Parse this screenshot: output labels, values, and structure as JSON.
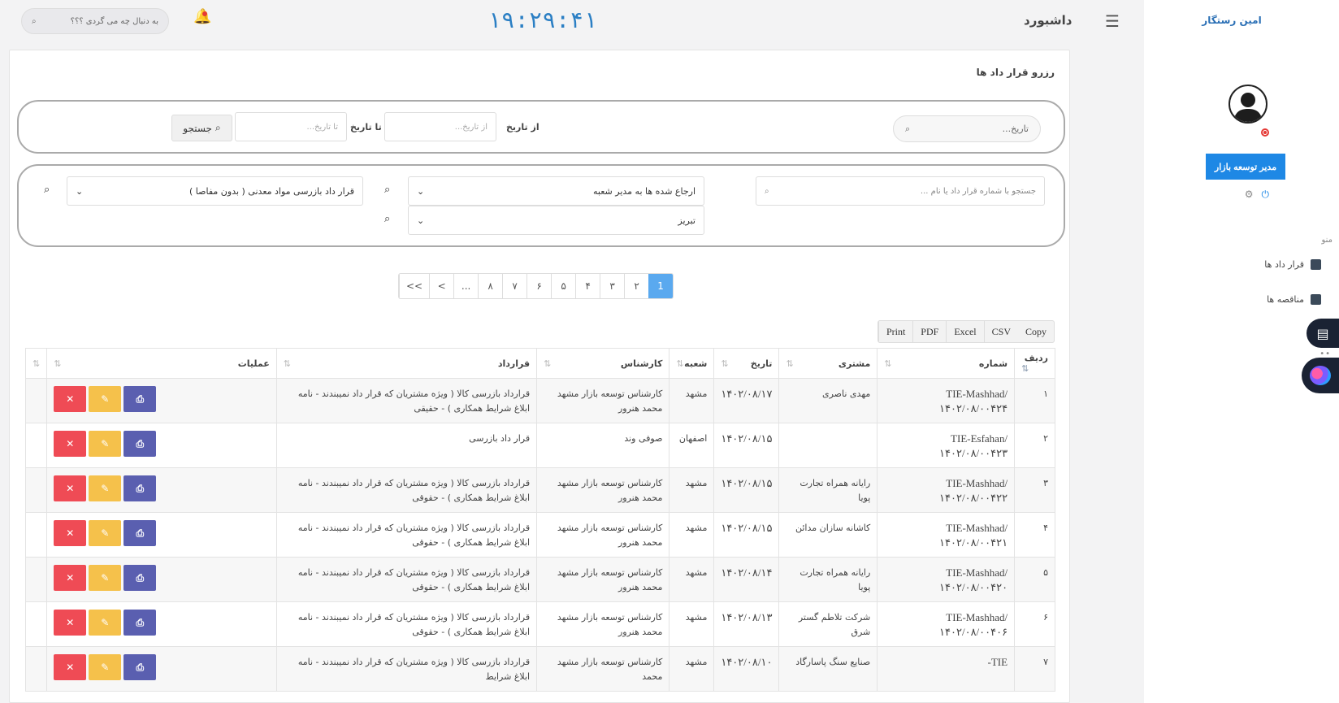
{
  "sidebar": {
    "user_name": "امین رستگار",
    "role_button": "مدیر توسعه بازار",
    "menu_title": "منو",
    "items": [
      {
        "label": "قرار داد ها"
      },
      {
        "label": "مناقصه ها"
      }
    ]
  },
  "header": {
    "title": "داشبورد",
    "clock": "۱۹:۲۹:۴۱",
    "search_placeholder": "به دنبال چه می گردی ؟؟؟"
  },
  "card": {
    "title": "رزرو قرار داد ها",
    "date_search_placeholder": "تاریخ...",
    "from_date_label": "از تاریخ",
    "from_date_placeholder": "از تاریخ...",
    "to_date_label": "تا تاریخ",
    "to_date_placeholder": "تا تاریخ...",
    "search_button": "جستجو",
    "contract_search_placeholder": "جستجو با شماره قرار داد یا نام ...",
    "status_select": "ارجاع شده ها به مدیر شعبه",
    "city_select": "تبریز",
    "type_select": "قرار داد بازرسی مواد معدنی ( بدون مفاصا )"
  },
  "pagination": [
    "1",
    "۲",
    "۳",
    "۴",
    "۵",
    "۶",
    "۷",
    "۸",
    "...",
    ">",
    ">>"
  ],
  "exports": [
    "Copy",
    "CSV",
    "Excel",
    "PDF",
    "Print"
  ],
  "table": {
    "headers": [
      "ردیف",
      "شماره",
      "مشتری",
      "تاریخ",
      "شعبه",
      "کارشناس",
      "قرارداد",
      "عملیات"
    ],
    "rows": [
      {
        "idx": "۱",
        "number": "TIE-Mashhad/۱۴۰۲/۰۸/۰۰۴۲۴",
        "customer": "مهدی ناصری",
        "date": "۱۴۰۲/۰۸/۱۷",
        "branch": "مشهد",
        "expert": "کارشناس توسعه بازار مشهد محمد هنرور",
        "contract": "قرارداد بازرسی کالا ( ویژه مشتریان که قرار داد نمیبندند - نامه ابلاغ شرایط همکاری ) - حقیقی"
      },
      {
        "idx": "۲",
        "number": "TIE-Esfahan/۱۴۰۲/۰۸/۰۰۴۲۳",
        "customer": "",
        "date": "۱۴۰۲/۰۸/۱۵",
        "branch": "اصفهان",
        "expert": "صوفی وند",
        "contract": "قرار داد بازرسی"
      },
      {
        "idx": "۳",
        "number": "TIE-Mashhad/۱۴۰۲/۰۸/۰۰۴۲۲",
        "customer": "رایانه همراه تجارت پویا",
        "date": "۱۴۰۲/۰۸/۱۵",
        "branch": "مشهد",
        "expert": "کارشناس توسعه بازار مشهد محمد هنرور",
        "contract": "قرارداد بازرسی کالا ( ویژه مشتریان که قرار داد نمیبندند - نامه ابلاغ شرایط همکاری ) - حقوقی"
      },
      {
        "idx": "۴",
        "number": "TIE-Mashhad/۱۴۰۲/۰۸/۰۰۴۲۱",
        "customer": "کاشانه سازان مدائن",
        "date": "۱۴۰۲/۰۸/۱۵",
        "branch": "مشهد",
        "expert": "کارشناس توسعه بازار مشهد محمد هنرور",
        "contract": "قرارداد بازرسی کالا ( ویژه مشتریان که قرار داد نمیبندند - نامه ابلاغ شرایط همکاری ) - حقوقی"
      },
      {
        "idx": "۵",
        "number": "TIE-Mashhad/۱۴۰۲/۰۸/۰۰۴۲۰",
        "customer": "رایانه همراه تجارت پویا",
        "date": "۱۴۰۲/۰۸/۱۴",
        "branch": "مشهد",
        "expert": "کارشناس توسعه بازار مشهد محمد هنرور",
        "contract": "قرارداد بازرسی کالا ( ویژه مشتریان که قرار داد نمیبندند - نامه ابلاغ شرایط همکاری ) - حقوقی"
      },
      {
        "idx": "۶",
        "number": "TIE-Mashhad/۱۴۰۲/۰۸/۰۰۴۰۶",
        "customer": "شرکت تلاطم گستر شرق",
        "date": "۱۴۰۲/۰۸/۱۳",
        "branch": "مشهد",
        "expert": "کارشناس توسعه بازار مشهد محمد هنرور",
        "contract": "قرارداد بازرسی کالا ( ویژه مشتریان که قرار داد نمیبندند - نامه ابلاغ شرایط همکاری ) - حقوقی"
      },
      {
        "idx": "۷",
        "number": "TIE-",
        "customer": "صنایع سنگ پاسارگاد",
        "date": "۱۴۰۲/۰۸/۱۰",
        "branch": "مشهد",
        "expert": "کارشناس توسعه بازار مشهد محمد",
        "contract": "قرارداد بازرسی کالا ( ویژه مشتریان که قرار داد نمیبندند - نامه ابلاغ شرایط"
      }
    ]
  },
  "colors": {
    "accent": "#1e88e5",
    "clock": "#2b7fc4",
    "print": "#5a5fb0",
    "edit": "#f5c14b",
    "delete": "#ef4b55",
    "active_page": "#5aa9ef"
  },
  "icons": {
    "menu": "hamburger-icon",
    "bell": "bell-icon",
    "search": "search-icon",
    "print": "print-icon",
    "edit": "edit-icon",
    "delete": "close-icon"
  }
}
